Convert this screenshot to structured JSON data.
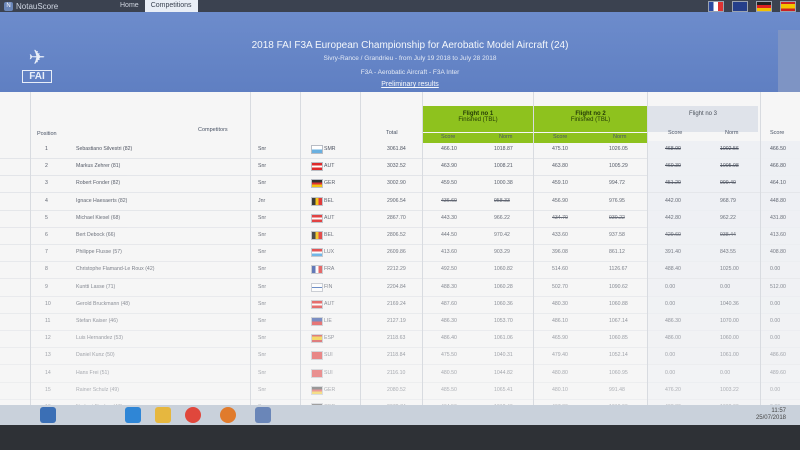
{
  "app": {
    "name": "NotauScore"
  },
  "nav": {
    "home": "Home",
    "competitions": "Competitions"
  },
  "header": {
    "title": "2018 FAI F3A European Championship for Aerobatic Model Aircraft (24)",
    "subtitle": "Sivry-Rance / Grandrieu - from July 19 2018 to July 28 2018",
    "class_line": "F3A - Aerobatic Aircraft - F3A Inter",
    "results_link": "Preliminary results",
    "logo_text": "FAI"
  },
  "table": {
    "headers": {
      "position": "Position",
      "competitors": "Competitors",
      "total": "Total",
      "flight1": "Flight no 1",
      "flight1_status": "Finished (TBL)",
      "flight2": "Flight no 2",
      "flight2_status": "Finished (TBL)",
      "flight3": "Flight no 3",
      "score": "Score",
      "norm": "Norm"
    },
    "rows": [
      {
        "pos": "1",
        "name": "Sebastiano Silvestri (82)",
        "cls": "Snr",
        "nation": "SMR",
        "total": "3061.84",
        "f1s": "466.10",
        "f1n": "1018.87",
        "f2s": "475.10",
        "f2n": "1026.05",
        "f3s": "468.00",
        "f3n": "1002.56",
        "f4s": "466.50"
      },
      {
        "pos": "2",
        "name": "Markus Zehrer (81)",
        "cls": "Snr",
        "nation": "AUT",
        "total": "3032.52",
        "f1s": "463.90",
        "f1n": "1008.21",
        "f2s": "463.80",
        "f2n": "1005.29",
        "f3s": "460.30",
        "f3n": "1005.98",
        "f4s": "466.80"
      },
      {
        "pos": "3",
        "name": "Robert Fonder (82)",
        "cls": "Snr",
        "nation": "GER",
        "total": "3002.90",
        "f1s": "459.50",
        "f1n": "1000.38",
        "f2s": "459.10",
        "f2n": "994.72",
        "f3s": "451.20",
        "f3n": "999.40",
        "f4s": "464.10"
      },
      {
        "pos": "4",
        "name": "Ignace Haesaerts (82)",
        "cls": "Jnr",
        "nation": "BEL",
        "total": "2906.54",
        "f1s": "436.60",
        "f1n": "958.33",
        "f2s": "456.90",
        "f2n": "976.95",
        "f3s": "442.00",
        "f3n": "968.79",
        "f4s": "448.80"
      },
      {
        "pos": "5",
        "name": "Michael Kiesel (68)",
        "cls": "Snr",
        "nation": "AUT",
        "total": "2867.70",
        "f1s": "443.30",
        "f1n": "966.22",
        "f2s": "434.70",
        "f2n": "930.22",
        "f3s": "442.80",
        "f3n": "962.22",
        "f4s": "431.80"
      },
      {
        "pos": "6",
        "name": "Bert Debock (66)",
        "cls": "Snr",
        "nation": "BEL",
        "total": "2806.52",
        "f1s": "444.50",
        "f1n": "970.42",
        "f2s": "433.60",
        "f2n": "937.58",
        "f3s": "429.60",
        "f3n": "938.44",
        "f4s": "413.60"
      },
      {
        "pos": "7",
        "name": "Philippe Flusse (57)",
        "cls": "Snr",
        "nation": "LUX",
        "total": "2609.86",
        "f1s": "413.60",
        "f1n": "903.29",
        "f2s": "396.08",
        "f2n": "861.12",
        "f3s": "391.40",
        "f3n": "843.55",
        "f4s": "408.80"
      },
      {
        "pos": "8",
        "name": "Christophe Flamand-Le Roux (42)",
        "cls": "Snr",
        "nation": "FRA",
        "total": "2212.29",
        "f1s": "492.50",
        "f1n": "1060.82",
        "f2s": "514.60",
        "f2n": "1126.67",
        "f3s": "488.40",
        "f3n": "1025.00",
        "f4s": "0.00"
      },
      {
        "pos": "9",
        "name": "Kuntti Lasse (71)",
        "cls": "Snr",
        "nation": "FIN",
        "total": "2204.84",
        "f1s": "488.30",
        "f1n": "1060.28",
        "f2s": "502.70",
        "f2n": "1090.62",
        "f3s": "0.00",
        "f3n": "0.00",
        "f4s": "512.00"
      },
      {
        "pos": "10",
        "name": "Gerold Bruckmann (48)",
        "cls": "Snr",
        "nation": "AUT",
        "total": "2169.24",
        "f1s": "487.60",
        "f1n": "1060.36",
        "f2s": "480.30",
        "f2n": "1060.88",
        "f3s": "0.00",
        "f3n": "1040.36",
        "f4s": "0.00"
      },
      {
        "pos": "11",
        "name": "Stefan Kaiser (46)",
        "cls": "Snr",
        "nation": "LIE",
        "total": "2127.19",
        "f1s": "486.30",
        "f1n": "1053.70",
        "f2s": "486.10",
        "f2n": "1067.14",
        "f3s": "486.30",
        "f3n": "1070.00",
        "f4s": "0.00"
      },
      {
        "pos": "12",
        "name": "Luis Hernandez (53)",
        "cls": "Snr",
        "nation": "ESP",
        "total": "2118.63",
        "f1s": "486.40",
        "f1n": "1061.06",
        "f2s": "465.90",
        "f2n": "1060.85",
        "f3s": "486.00",
        "f3n": "1060.00",
        "f4s": "0.00"
      },
      {
        "pos": "13",
        "name": "Daniel Kunz (50)",
        "cls": "Snr",
        "nation": "SUI",
        "total": "2118.84",
        "f1s": "475.50",
        "f1n": "1040.31",
        "f2s": "479.40",
        "f2n": "1052.14",
        "f3s": "0.00",
        "f3n": "1061.00",
        "f4s": "486.60"
      },
      {
        "pos": "14",
        "name": "Hans Frei (51)",
        "cls": "Snr",
        "nation": "SUI",
        "total": "2116.10",
        "f1s": "480.50",
        "f1n": "1044.82",
        "f2s": "480.80",
        "f2n": "1060.95",
        "f3s": "0.00",
        "f3n": "0.00",
        "f4s": "489.60"
      },
      {
        "pos": "15",
        "name": "Rainer Schulz (49)",
        "cls": "Snr",
        "nation": "GER",
        "total": "2080.52",
        "f1s": "485.50",
        "f1n": "1065.41",
        "f2s": "480.10",
        "f2n": "991.48",
        "f3s": "476.20",
        "f3n": "1003.22",
        "f4s": "0.00"
      },
      {
        "pos": "16",
        "name": "Norbert Fischer (47)",
        "cls": "Snr",
        "nation": "GER",
        "total": "2072.74",
        "f1s": "464.50",
        "f1n": "1012.40",
        "f2s": "467.30",
        "f2n": "1010.90",
        "f3s": "468.80",
        "f3n": "1000.00",
        "f4s": "0.00"
      },
      {
        "pos": "17",
        "name": "Marco Rossi (45)",
        "cls": "Snr",
        "nation": "ITA",
        "total": "2062.32",
        "f1s": "482.30",
        "f1n": "1050.62",
        "f2s": "476.40",
        "f2n": "1055.60",
        "f3s": "0.00",
        "f3n": "1021.00",
        "f4s": "477.00"
      }
    ]
  },
  "taskbar": {
    "time": "11:57",
    "date": "25/07/2018"
  },
  "colors": {
    "banner": "#6584c4",
    "flight_green": "#8ec21e",
    "topbar": "#3b4250"
  }
}
